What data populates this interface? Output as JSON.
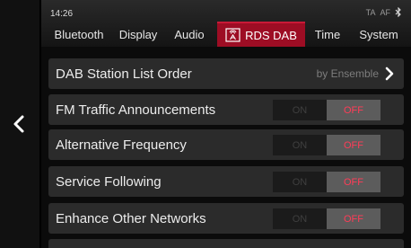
{
  "status_bar": {
    "time": "14:26",
    "ta": "TA",
    "af": "AF",
    "bluetooth_icon": "bluetooth-icon"
  },
  "tabs": [
    {
      "label": "Bluetooth",
      "active": false
    },
    {
      "label": "Display",
      "active": false
    },
    {
      "label": "Audio",
      "active": false
    },
    {
      "label": "RDS DAB",
      "active": true,
      "icon": "radio-icon"
    },
    {
      "label": "Time",
      "active": false
    },
    {
      "label": "System",
      "active": false
    }
  ],
  "back_icon": "chevron-left-icon",
  "settings": [
    {
      "label": "DAB Station List Order",
      "value": "by Ensemble",
      "icon": "chevron-right-icon"
    },
    {
      "label": "FM Traffic Announcements",
      "on": "ON",
      "off": "OFF",
      "state": "OFF"
    },
    {
      "label": "Alternative Frequency",
      "on": "ON",
      "off": "OFF",
      "state": "OFF"
    },
    {
      "label": "Service Following",
      "on": "ON",
      "off": "OFF",
      "state": "OFF"
    },
    {
      "label": "Enhance Other Networks",
      "on": "ON",
      "off": "OFF",
      "state": "OFF"
    }
  ],
  "colors": {
    "accent": "#9d0d24",
    "off_text": "#ff3c57",
    "row_bg": "#2b2b2b"
  }
}
